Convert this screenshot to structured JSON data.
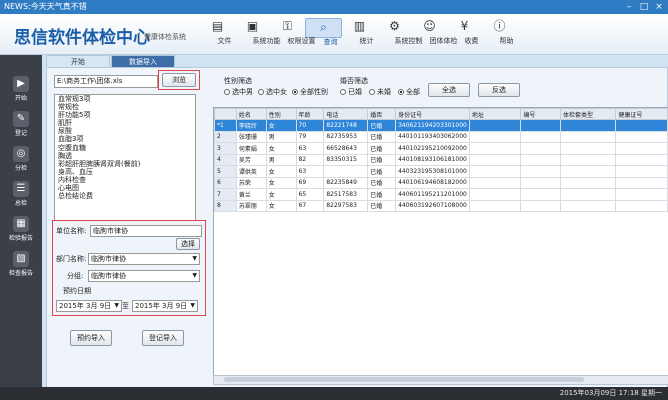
{
  "window": {
    "title": "NEWS:今天天气真不错"
  },
  "brand": {
    "title": "思信软件体检中心",
    "subtitle": "健康体检系统"
  },
  "toolbar": [
    {
      "label": "文件",
      "icon": "file-icon"
    },
    {
      "label": "系统功能",
      "icon": "system-icon"
    },
    {
      "label": "权限设置",
      "icon": "permission-icon"
    },
    {
      "label": "查询",
      "icon": "query-icon"
    },
    {
      "label": "统计",
      "icon": "stats-icon"
    },
    {
      "label": "系统控制",
      "icon": "control-icon"
    },
    {
      "label": "团体体检",
      "icon": "group-icon"
    },
    {
      "label": "收费",
      "icon": "fee-icon"
    },
    {
      "label": "帮助",
      "icon": "help-icon"
    }
  ],
  "sidebar": [
    {
      "label": "开始",
      "icon": "start-icon"
    },
    {
      "label": "登记",
      "icon": "register-icon"
    },
    {
      "label": "分检",
      "icon": "check-icon"
    },
    {
      "label": "总检",
      "icon": "summary-icon"
    },
    {
      "label": "检验报告",
      "icon": "lab-report-icon"
    },
    {
      "label": "检查报告",
      "icon": "exam-report-icon"
    }
  ],
  "tabs": [
    {
      "label": "开始"
    },
    {
      "label": "数据导入"
    }
  ],
  "import": {
    "path": "E:\\商务工作\\团体.xls",
    "browse_label": "浏览",
    "packages": [
      "血常规3项",
      "常规检",
      "肝功能5项",
      "肌酐",
      "尿酸",
      "血脂3项",
      "空腹血糖",
      "胸透",
      "彩超肝胆脾胰肾双肾(餐前)",
      "身高、血压",
      "内科检查",
      "心电图",
      "总检结论费"
    ]
  },
  "unit": {
    "label": "单位名称:",
    "value": "临朐市律协",
    "select_label": "选择",
    "dept_label": "部门名称:",
    "dept_value": "临朐市律协",
    "group_label": "分组:",
    "group_value": "临朐市律协",
    "reserve_label": "预约日期",
    "date_from": "2015年 3月 9日",
    "date_sep": "至",
    "date_to": "2015年 3月 9日"
  },
  "actions": {
    "reserve": "预约导入",
    "register": "登记导入"
  },
  "filters": {
    "gender_title": "性别筛选",
    "gender_options": [
      "选中男",
      "选中女",
      "全部性别"
    ],
    "marriage_title": "婚否筛选",
    "marriage_options": [
      "已婚",
      "未婚",
      "全部"
    ],
    "select_all": "全选",
    "invert": "反选"
  },
  "table": {
    "columns": [
      "",
      "姓名",
      "性别",
      "年龄",
      "电话",
      "婚否",
      "身份证号",
      "地址",
      "编号",
      "体检套类型",
      "健康证号"
    ],
    "rows": [
      [
        "*1",
        "李晓玲",
        "女",
        "70",
        "82221748",
        "已婚",
        "340621194203301000",
        "",
        "",
        "",
        ""
      ],
      [
        "2",
        "张瑾珊",
        "男",
        "79",
        "82735953",
        "已婚",
        "440101193403062000",
        "",
        "",
        "",
        ""
      ],
      [
        "3",
        "何素娟",
        "女",
        "63",
        "66528643",
        "已婚",
        "440102195210092000",
        "",
        "",
        "",
        ""
      ],
      [
        "4",
        "吴芳",
        "男",
        "82",
        "83350315",
        "已婚",
        "440108193106181000",
        "",
        "",
        "",
        ""
      ],
      [
        "5",
        "谭供英",
        "女",
        "63",
        "",
        "已婚",
        "440323195308101000",
        "",
        "",
        "",
        ""
      ],
      [
        "6",
        "苏荣",
        "女",
        "69",
        "82235849",
        "已婚",
        "440106194608182000",
        "",
        "",
        "",
        ""
      ],
      [
        "7",
        "黄兰",
        "女",
        "65",
        "82517583",
        "已婚",
        "440601195211201000",
        "",
        "",
        "",
        ""
      ],
      [
        "8",
        "苏翠丽",
        "女",
        "67",
        "82297583",
        "已婚",
        "440603192607108000",
        "",
        "",
        "",
        ""
      ]
    ]
  },
  "footer": {
    "datetime": "2015年03月09日 17:18 星期一"
  }
}
